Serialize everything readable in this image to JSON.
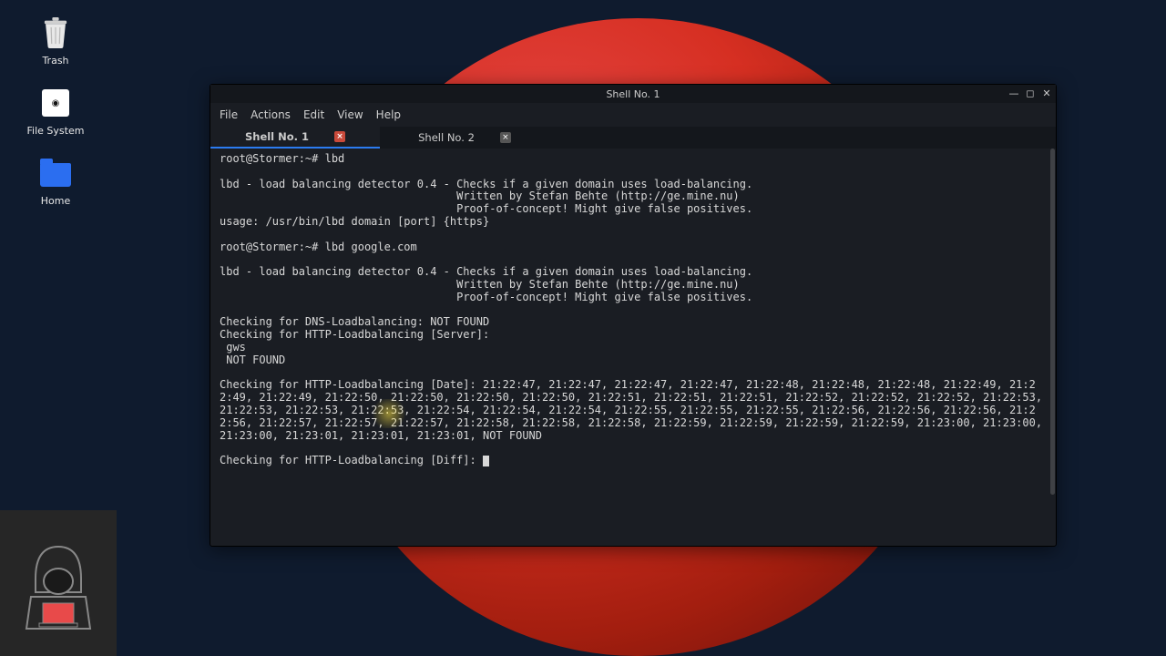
{
  "desktop": {
    "trash": "Trash",
    "filesystem": "File System",
    "home": "Home"
  },
  "window": {
    "title": "Shell No. 1",
    "menu": {
      "file": "File",
      "actions": "Actions",
      "edit": "Edit",
      "view": "View",
      "help": "Help"
    },
    "tabs": [
      {
        "label": "Shell No. 1"
      },
      {
        "label": "Shell No. 2"
      }
    ]
  },
  "terminal": {
    "prompt1": "root@Stormer:~# ",
    "cmd1": "lbd",
    "banner1": "lbd - load balancing detector 0.4 - Checks if a given domain uses load-balancing.\n                                    Written by Stefan Behte (http://ge.mine.nu)\n                                    Proof-of-concept! Might give false positives.\nusage: /usr/bin/lbd domain [port] {https}",
    "prompt2": "root@Stormer:~# ",
    "cmd2": "lbd google.com",
    "banner2": "lbd - load balancing detector 0.4 - Checks if a given domain uses load-balancing.\n                                    Written by Stefan Behte (http://ge.mine.nu)\n                                    Proof-of-concept! Might give false positives.",
    "dns": "Checking for DNS-Loadbalancing: NOT FOUND",
    "http_server": "Checking for HTTP-Loadbalancing [Server]:\n gws\n NOT FOUND",
    "http_date": "Checking for HTTP-Loadbalancing [Date]: 21:22:47, 21:22:47, 21:22:47, 21:22:47, 21:22:48, 21:22:48, 21:22:48, 21:22:49, 21:22:49, 21:22:49, 21:22:50, 21:22:50, 21:22:50, 21:22:50, 21:22:51, 21:22:51, 21:22:51, 21:22:52, 21:22:52, 21:22:52, 21:22:53, 21:22:53, 21:22:53, 21:22:53, 21:22:54, 21:22:54, 21:22:54, 21:22:55, 21:22:55, 21:22:55, 21:22:56, 21:22:56, 21:22:56, 21:22:56, 21:22:57, 21:22:57, 21:22:57, 21:22:58, 21:22:58, 21:22:58, 21:22:59, 21:22:59, 21:22:59, 21:22:59, 21:23:00, 21:23:00, 21:23:00, 21:23:01, 21:23:01, 21:23:01, NOT FOUND",
    "http_diff": "Checking for HTTP-Loadbalancing [Diff]: "
  }
}
